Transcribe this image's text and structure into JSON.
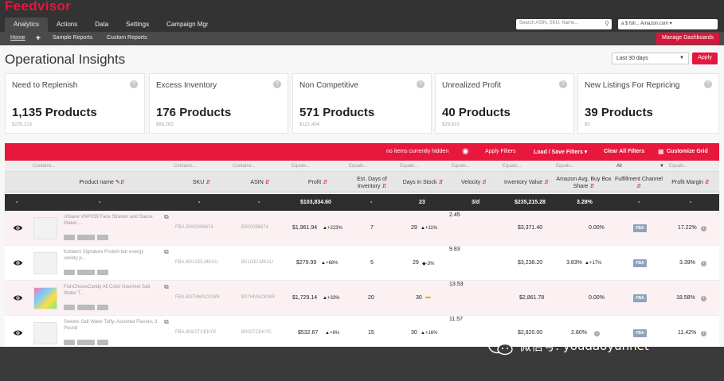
{
  "app": {
    "name": "Feedvisor"
  },
  "nav": {
    "tabs": [
      {
        "label": "Analytics"
      },
      {
        "label": "Actions"
      },
      {
        "label": "Data"
      },
      {
        "label": "Settings"
      },
      {
        "label": "Campaign Mgr"
      }
    ],
    "search_placeholder": "Search ASIN, SKU, Name...",
    "account": "a $ foll... Amazon.com",
    "subnav": [
      {
        "label": "Home"
      },
      {
        "label": "✚"
      },
      {
        "label": "Sample Reports"
      },
      {
        "label": "Custom Reports"
      }
    ],
    "manage_dashboards": "Manage Dashboards"
  },
  "page": {
    "title": "Operational Insights",
    "date_range": "Last 30 days",
    "apply": "Apply"
  },
  "cards": [
    {
      "label": "Need to Replenish",
      "value": "1,135 Products",
      "sub": "$235,215"
    },
    {
      "label": "Excess Inventory",
      "value": "176 Products",
      "sub": "$88,262"
    },
    {
      "label": "Non Competitive",
      "value": "571 Products",
      "sub": "$121,454"
    },
    {
      "label": "Unrealized Profit",
      "value": "40 Products",
      "sub": "$29,833"
    },
    {
      "label": "New Listings For Repricing",
      "value": "39 Products",
      "sub": "$0"
    }
  ],
  "filter_bar": {
    "hidden_text": "no items currently hidden",
    "apply_filters": "Apply Filters",
    "load_save": "Load / Save Filters ▾",
    "clear_all": "Clear All Filters",
    "customize": "Customize Grid"
  },
  "table": {
    "filter_row": [
      "Contains...",
      "Contains...",
      "Contains...",
      "Equals...",
      "Equals...",
      "Equals...",
      "Equals...",
      "Equals...",
      "Equals...",
      "All",
      "Equals..."
    ],
    "headers": [
      "Product name",
      "SKU",
      "ASIN",
      "Profit",
      "Est. Days of Inventory",
      "Days in Stock",
      "Velocity",
      "Inventory Value",
      "Amazon Avg. Buy Box Share",
      "Fulfillment Channel",
      "Profit Margin"
    ],
    "totals": [
      "-",
      "-",
      "-",
      "-",
      "$103,834.60",
      "-",
      "23",
      "3/d",
      "$235,215.28",
      "3.28%",
      "-",
      "-"
    ],
    "rows": [
      {
        "name": "Urbane VNP039 Face Strainer and Sauce Maker ...",
        "sku": "FBA-B000096674",
        "asin": "B000096674",
        "profit": "$1,961.94",
        "profit_delta": "+223%",
        "est_days": "7",
        "days_in_stock": "29",
        "dis_delta": "+11%",
        "velocity": "2.45",
        "inv_value": "$3,371.40",
        "bb_share": "0.00%",
        "bb_delta": "",
        "channel": "FBA",
        "margin": "17.22%"
      },
      {
        "name": "Kobiarni Signature Protein bar energy variety p...",
        "sku": "FBA-B01GELMKAU",
        "asin": "B01GELMKAU",
        "profit": "$279.99",
        "profit_delta": "+68%",
        "est_days": "5",
        "days_in_stock": "29",
        "dis_delta": "-3%",
        "velocity": "9.83",
        "inv_value": "$3,238.20",
        "bb_share": "3.83%",
        "bb_delta": "+17%",
        "channel": "FBA",
        "margin": "3.39%"
      },
      {
        "name": "FishChoiceCandy All Color Gourmet Salt Water T...",
        "sku": "FBA-B07HMSCKWR",
        "asin": "B07HMSCKWR",
        "profit": "$1,729.14",
        "profit_delta": "+33%",
        "est_days": "20",
        "days_in_stock": "30",
        "dis_delta": "",
        "velocity": "13.53",
        "inv_value": "$2,861.78",
        "bb_share": "0.00%",
        "bb_delta": "",
        "channel": "FBA",
        "margin": "18.58%"
      },
      {
        "name": "Sweets Salt Water Taffy, Assorted Flavors, 3 Pound",
        "sku": "FBA-B002TCEKYE",
        "asin": "B002TCEKYE",
        "profit": "$532.67",
        "profit_delta": "+6%",
        "est_days": "15",
        "days_in_stock": "30",
        "dis_delta": "+16%",
        "velocity": "11.57",
        "inv_value": "$2,820.00",
        "bb_share": "2.80%",
        "bb_delta": "",
        "channel": "FBA",
        "margin": "11.42%"
      }
    ]
  },
  "watermark": "微信号: youdaoyunnet",
  "colors": {
    "brand": "#e3173e",
    "topbar": "#333333",
    "filter_bar": "#e8173c",
    "totals_bar": "#2e2e2e"
  }
}
